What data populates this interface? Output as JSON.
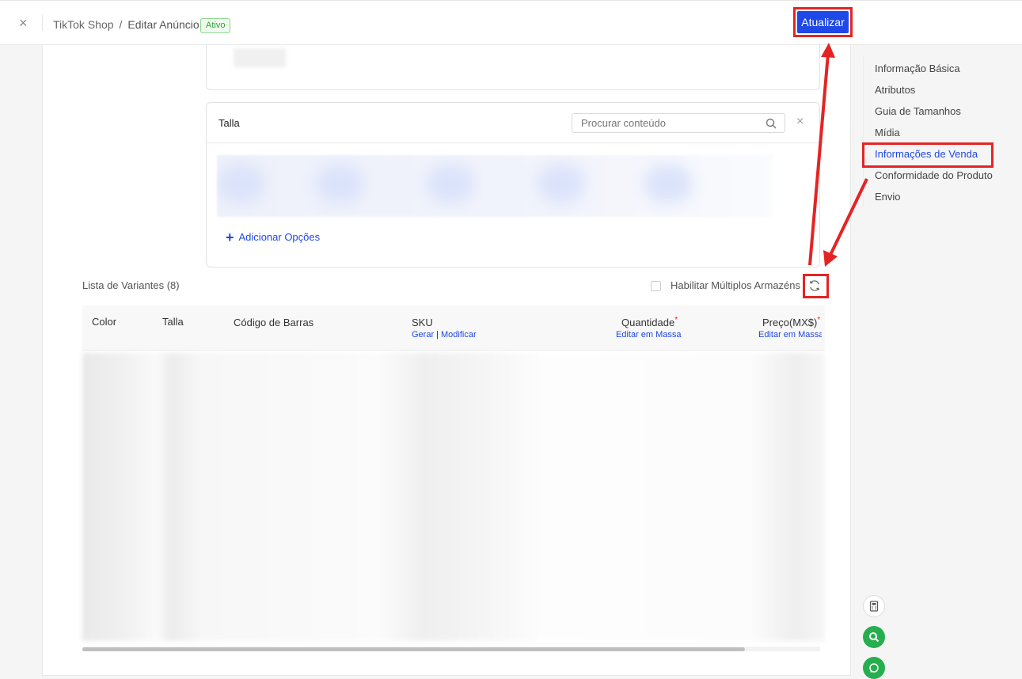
{
  "header": {
    "close": "×",
    "breadcrumb_root": "TikTok Shop",
    "breadcrumb_sep": "/",
    "breadcrumb_current": "Editar Anúncio",
    "status_badge": "Ativo",
    "update_button": "Atualizar"
  },
  "options_card": {
    "title": "Talla",
    "search_placeholder": "Procurar conteúdo",
    "close": "×",
    "add_options": "Adicionar Opções",
    "add_icon": "+"
  },
  "variants": {
    "title": "Lista de Variantes (8)",
    "multi_warehouse_label": "Habilitar Múltiplos Armazéns"
  },
  "table": {
    "columns": {
      "color": "Color",
      "talla": "Talla",
      "barcode": "Código de Barras",
      "sku": "SKU",
      "sku_generate": "Gerar",
      "sku_sep": "|",
      "sku_modify": "Modificar",
      "quantity": "Quantidade",
      "quantity_bulk": "Editar em Massa",
      "price": "Preço(MX$)",
      "price_bulk": "Editar em Massa",
      "required_mark": "*"
    }
  },
  "side_nav": {
    "items": [
      "Informação Básica",
      "Atributos",
      "Guia de Tamanhos",
      "Mídia",
      "Informações de Venda",
      "Conformidade do Produto",
      "Envio"
    ],
    "active_index": 4
  },
  "colors": {
    "primary": "#1f48e8",
    "annotation_red": "#e42424",
    "status_green": "#2da52d",
    "whatsapp_green": "#27ae4e"
  },
  "icons": [
    "close-icon",
    "search-icon",
    "refresh-icon",
    "plus-icon",
    "calculator-icon",
    "magnifier-icon",
    "whatsapp-icon"
  ]
}
